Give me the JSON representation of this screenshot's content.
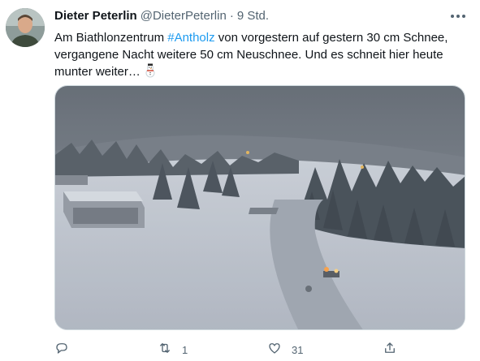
{
  "tweet": {
    "display_name": "Dieter Peterlin",
    "handle": "@DieterPeterlin",
    "separator": "·",
    "timestamp": "9 Std.",
    "text_before": "Am Biathlonzentrum ",
    "hashtag": "#Antholz",
    "text_after": " von vorgestern auf gestern 30 cm Schnee, vergangene Nacht weitere 50 cm Neuschnee. Und es schneit hier heute munter weiter…",
    "emoji": "snowman-icon"
  },
  "actions": {
    "reply_count": "",
    "retweet_count": "1",
    "like_count": "31",
    "share_count": ""
  },
  "colors": {
    "text": "#0f1419",
    "secondary": "#536471",
    "link": "#1d9bf0"
  },
  "icons": [
    "more-icon",
    "reply-icon",
    "retweet-icon",
    "like-icon",
    "share-icon",
    "snowman-icon"
  ]
}
